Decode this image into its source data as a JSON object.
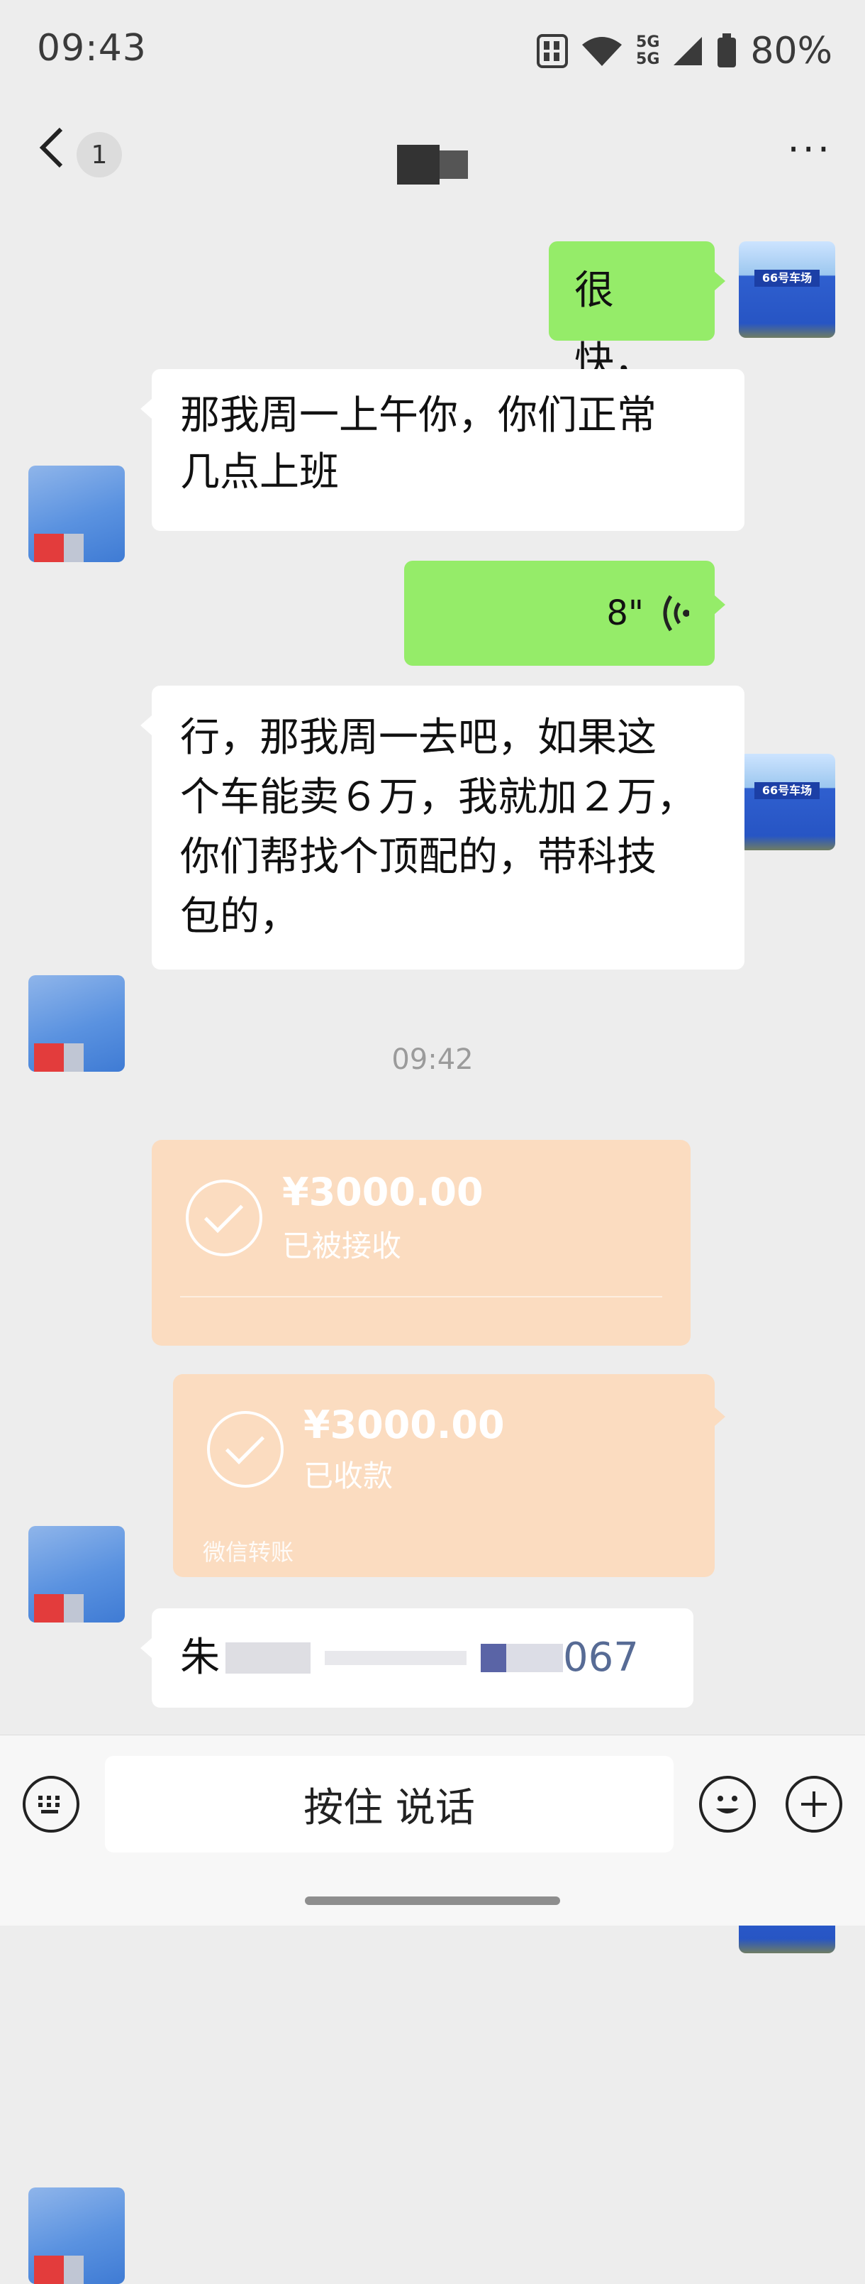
{
  "status_bar": {
    "time": "09:43",
    "network_top": "5G",
    "network_bottom": "5G",
    "battery": "80%"
  },
  "nav": {
    "unread_count": "1",
    "more": "···"
  },
  "messages": {
    "m1": "很快，",
    "m2_line1": "那我周一上午你，你们正常",
    "m2_line2": "几点上班",
    "m3_duration": "8\"",
    "m4_line1": "行，那我周一去吧，如果这",
    "m4_line2": "个车能卖６万，我就加２万，",
    "m4_line3": "你们帮找个顶配的，带科技",
    "m4_line4": "包的，",
    "timestamp": "09:42",
    "last_prefix": "朱",
    "last_suffix": "067"
  },
  "transfers": {
    "incoming": {
      "amount": "¥3000.00",
      "status": "已被接收"
    },
    "outgoing": {
      "amount": "¥3000.00",
      "status": "已收款",
      "footer": "微信转账"
    }
  },
  "avatar_me": {
    "sign": "66号车场"
  },
  "bottom": {
    "hold_to_talk": "按住 说话"
  },
  "colors": {
    "background": "#ededed",
    "sent_bubble": "#95ec69",
    "received_bubble": "#ffffff",
    "transfer_card": "#fbdcc0"
  },
  "icons": [
    "back-chevron-icon",
    "voice-wave-icon",
    "check-circle-icon",
    "keyboard-icon",
    "emoji-icon",
    "plus-icon",
    "wifi-icon",
    "signal-icon",
    "battery-icon"
  ]
}
